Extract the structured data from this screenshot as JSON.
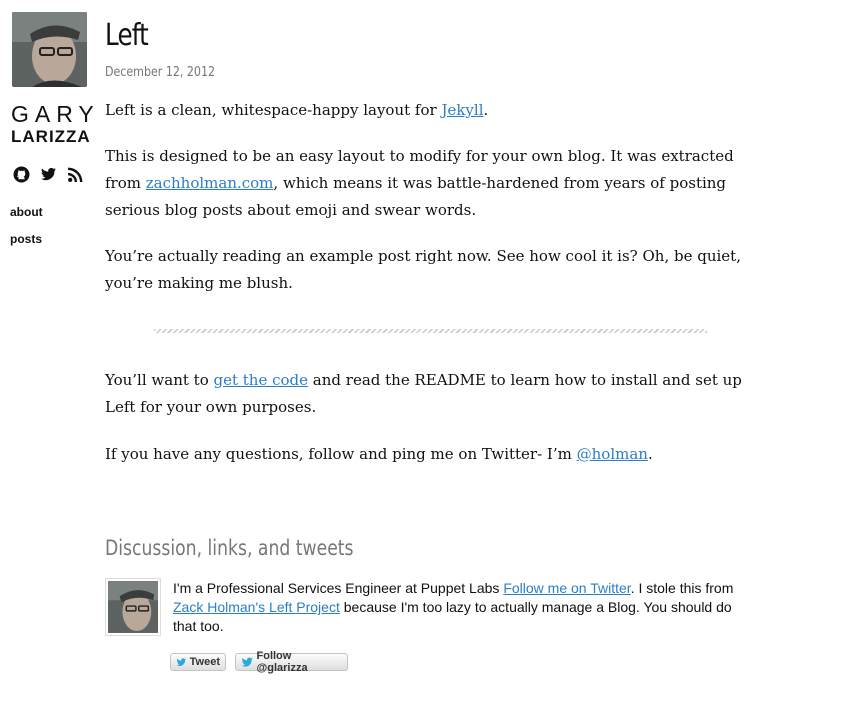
{
  "sidebar": {
    "name_first": "GARY",
    "name_last": "LARIZZA",
    "social_icons": [
      "github-icon",
      "twitter-icon",
      "rss-icon"
    ],
    "nav": [
      {
        "label": "about"
      },
      {
        "label": "posts"
      }
    ]
  },
  "post": {
    "title": "Left",
    "date": "December 12, 2012",
    "p1": {
      "text": "Left is a clean, whitespace-happy layout for ",
      "link": "Jekyll",
      "end": "."
    },
    "p2": {
      "text": "This is designed to be an easy layout to modify for your own blog. It was extracted from ",
      "link": "zachholman.com",
      "end": ", which means it was battle-hardened from years of posting serious blog posts about emoji and swear words."
    },
    "p3": {
      "text": "You’re actually reading an example post right now. See how cool it is? Oh, be quiet, you’re making me blush."
    },
    "p4": {
      "text": "You’ll want to ",
      "link": "get the code",
      "end": " and read the README to learn how to install and set up Left for your own purposes."
    },
    "p5": {
      "text": "If you have any questions, follow and ping me on Twitter- I’m ",
      "link": "@holman",
      "end": "."
    }
  },
  "discussion": {
    "heading": "Discussion, links, and tweets",
    "bio_text_1": "I'm a Professional Services Engineer at Puppet Labs ",
    "bio_link_1": "Follow me on Twitter",
    "bio_text_2": ". I stole this from ",
    "bio_link_2": "Zack Holman's Left Project",
    "bio_text_3": " because I'm too lazy to actually manage a Blog. You should do that too.",
    "tweet_button": "Tweet",
    "follow_button": "Follow @glarizza"
  },
  "colors": {
    "link": "#2a7ec8",
    "muted": "#777777",
    "twitter_blue": "#2aa9e0"
  }
}
